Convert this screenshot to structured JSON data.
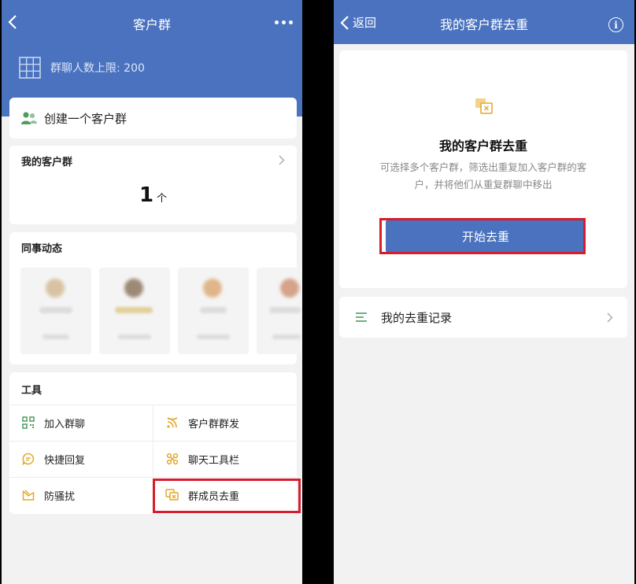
{
  "left": {
    "title": "客户群",
    "group_limit": "群聊人数上限: 200",
    "create_group": "创建一个客户群",
    "my_groups": {
      "title": "我的客户群",
      "count": "1",
      "unit": "个"
    },
    "colleague_feed": {
      "title": "同事动态"
    },
    "tools": {
      "title": "工具",
      "items": [
        {
          "label": "加入群聊",
          "icon": "qr-code-icon"
        },
        {
          "label": "客户群群发",
          "icon": "broadcast-icon"
        },
        {
          "label": "快捷回复",
          "icon": "chat-bubble-icon"
        },
        {
          "label": "聊天工具栏",
          "icon": "toolbar-icon"
        },
        {
          "label": "防骚扰",
          "icon": "shield-flag-icon"
        },
        {
          "label": "群成员去重",
          "icon": "dedupe-icon"
        }
      ]
    }
  },
  "right": {
    "back_label": "返回",
    "title": "我的客户群去重",
    "card_title": "我的客户群去重",
    "description": "可选择多个客户群，筛选出重复加入客户群的客户，并将他们从重复群聊中移出",
    "start_button": "开始去重",
    "records_label": "我的去重记录"
  },
  "colors": {
    "header_blue": "#4a72bf",
    "highlight_red": "#d61d2c",
    "icon_gold": "#e2a92b",
    "icon_green": "#4f9c5e"
  }
}
